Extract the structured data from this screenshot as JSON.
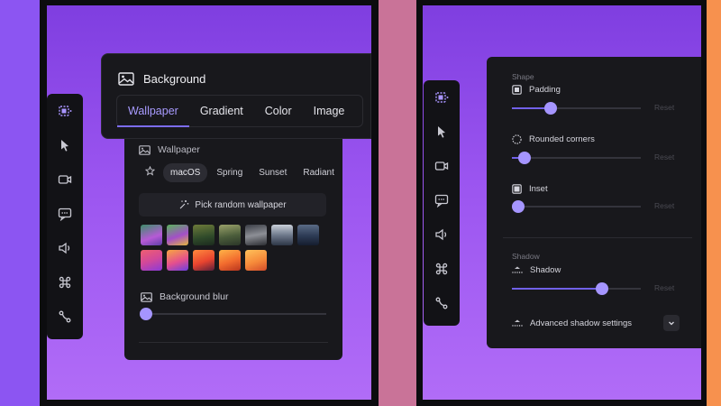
{
  "left_editor": {
    "background_panel": {
      "title": "Background",
      "icon": "image-icon",
      "tabs": [
        {
          "label": "Wallpaper",
          "active": true
        },
        {
          "label": "Gradient",
          "active": false
        },
        {
          "label": "Color",
          "active": false
        },
        {
          "label": "Image",
          "active": false
        }
      ]
    },
    "wallpaper_section": {
      "title": "Wallpaper",
      "categories": [
        {
          "label": "macOS",
          "active": true
        },
        {
          "label": "Spring",
          "active": false
        },
        {
          "label": "Sunset",
          "active": false
        },
        {
          "label": "Radiant",
          "active": false
        }
      ],
      "random_button": "Pick random wallpaper",
      "blur_label": "Background blur",
      "blur_value": 0.0
    }
  },
  "right_editor": {
    "shape_section": {
      "label": "Shape",
      "padding": {
        "label": "Padding",
        "value": 0.3,
        "reset": "Reset"
      },
      "rounded_corners": {
        "label": "Rounded corners",
        "value": 0.1,
        "reset": "Reset"
      },
      "inset": {
        "label": "Inset",
        "value": 0.0,
        "reset": "Reset"
      }
    },
    "shadow_section": {
      "label": "Shadow",
      "shadow": {
        "label": "Shadow",
        "value": 0.7,
        "reset": "Reset"
      },
      "advanced": "Advanced shadow settings"
    }
  },
  "toolbar": [
    "crop-select-icon",
    "cursor-icon",
    "video-icon",
    "caption-icon",
    "volume-icon",
    "command-icon",
    "path-icon"
  ],
  "colors": {
    "accent": "#a595ff",
    "panel": "#18181c",
    "canvas_top": "#7f3ee0",
    "canvas_bottom": "#b16cf7"
  }
}
